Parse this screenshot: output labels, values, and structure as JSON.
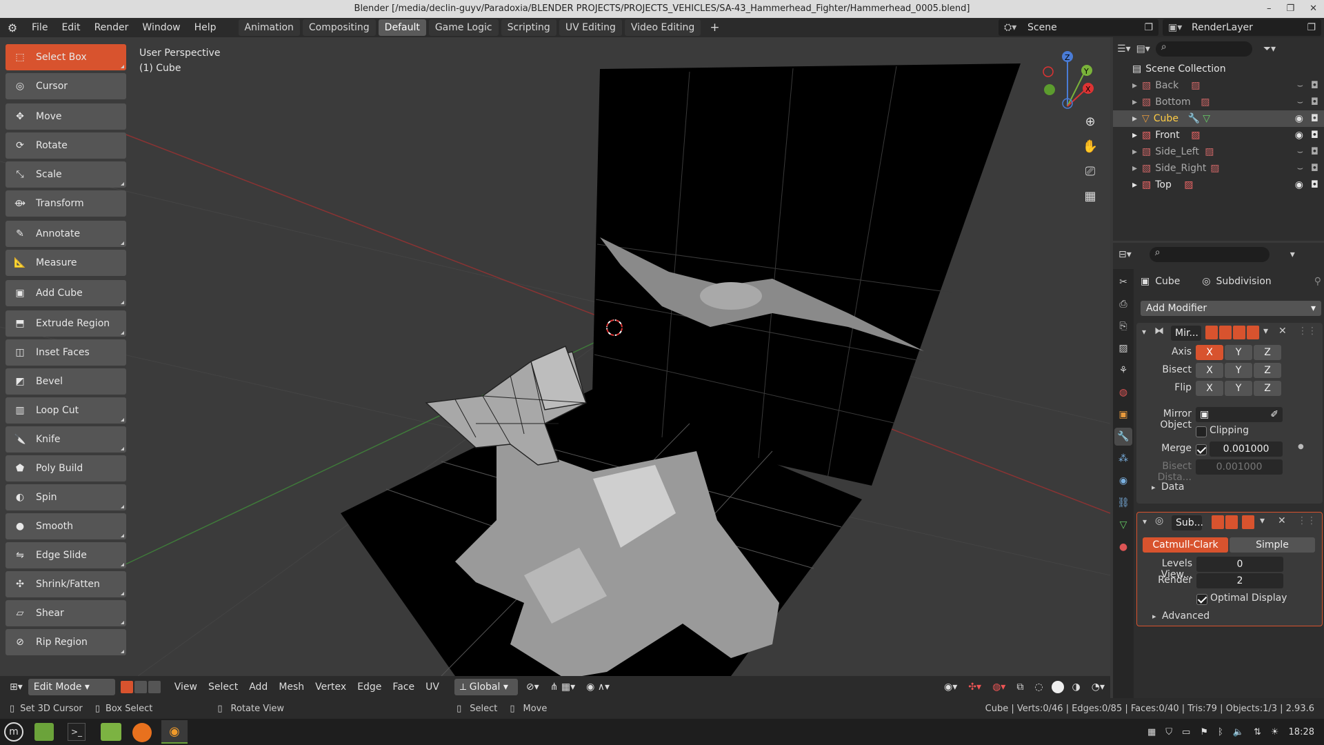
{
  "window": {
    "title": "Blender [/media/declin-guyv/Paradoxia/BLENDER PROJECTS/PROJECTS_VEHICLES/SA-43_Hammerhead_Fighter/Hammerhead_0005.blend]"
  },
  "menus": [
    "File",
    "Edit",
    "Render",
    "Window",
    "Help"
  ],
  "workspaces": [
    {
      "label": "Animation"
    },
    {
      "label": "Compositing"
    },
    {
      "label": "Default",
      "active": true
    },
    {
      "label": "Game Logic"
    },
    {
      "label": "Scripting"
    },
    {
      "label": "UV Editing"
    },
    {
      "label": "Video Editing"
    }
  ],
  "scene": {
    "label": "Scene",
    "render_layer": "RenderLayer"
  },
  "viewport": {
    "perspective": "User Perspective",
    "object": "(1) Cube"
  },
  "tools": [
    {
      "label": "Select Box",
      "icon": "select-box-icon",
      "active": true
    },
    {
      "label": "Cursor",
      "icon": "cursor-icon"
    },
    {
      "label": "Move",
      "icon": "move-icon"
    },
    {
      "label": "Rotate",
      "icon": "rotate-icon"
    },
    {
      "label": "Scale",
      "icon": "scale-icon"
    },
    {
      "label": "Transform",
      "icon": "transform-icon"
    },
    {
      "label": "Annotate",
      "icon": "annotate-icon"
    },
    {
      "label": "Measure",
      "icon": "measure-icon"
    },
    {
      "label": "Add Cube",
      "icon": "add-cube-icon"
    },
    {
      "label": "Extrude Region",
      "icon": "extrude-region-icon"
    },
    {
      "label": "Inset Faces",
      "icon": "inset-faces-icon"
    },
    {
      "label": "Bevel",
      "icon": "bevel-icon"
    },
    {
      "label": "Loop Cut",
      "icon": "loop-cut-icon"
    },
    {
      "label": "Knife",
      "icon": "knife-icon"
    },
    {
      "label": "Poly Build",
      "icon": "poly-build-icon"
    },
    {
      "label": "Spin",
      "icon": "spin-icon"
    },
    {
      "label": "Smooth",
      "icon": "smooth-icon"
    },
    {
      "label": "Edge Slide",
      "icon": "edge-slide-icon"
    },
    {
      "label": "Shrink/Fatten",
      "icon": "shrink-fatten-icon"
    },
    {
      "label": "Shear",
      "icon": "shear-icon"
    },
    {
      "label": "Rip Region",
      "icon": "rip-region-icon"
    }
  ],
  "vp_header": {
    "mode": "Edit Mode",
    "menus": [
      "View",
      "Select",
      "Add",
      "Mesh",
      "Vertex",
      "Edge",
      "Face",
      "UV"
    ],
    "orientation": "Global"
  },
  "statusbar": {
    "left": [
      "Set 3D Cursor",
      "Box Select",
      "Rotate View",
      "Select",
      "Move"
    ],
    "stats": "Cube | Verts:0/46 | Edges:0/85 | Faces:0/40 | Tris:79 | Objects:1/3 | 2.93.6"
  },
  "taskbar": {
    "time": "18:28"
  },
  "outliner": {
    "root": "Scene Collection",
    "items": [
      {
        "label": "Back",
        "state": "hidden"
      },
      {
        "label": "Bottom",
        "state": "hidden"
      },
      {
        "label": "Cube",
        "state": "active"
      },
      {
        "label": "Front",
        "state": "visible"
      },
      {
        "label": "Side_Left",
        "state": "hidden"
      },
      {
        "label": "Side_Right",
        "state": "hidden"
      },
      {
        "label": "Top",
        "state": "visible"
      }
    ]
  },
  "properties": {
    "object": "Cube",
    "modifier_context": "Subdivision",
    "add_modifier": "Add Modifier",
    "mirror": {
      "name": "Mir...",
      "axis_label": "Axis",
      "bisect_label": "Bisect",
      "flip_label": "Flip",
      "xyz": [
        "X",
        "Y",
        "Z"
      ],
      "mirror_object_label": "Mirror Object",
      "clipping_label": "Clipping",
      "merge_label": "Merge",
      "merge_value": "0.001000",
      "bisect_distance_label": "Bisect Dista...",
      "bisect_distance_value": "0.001000",
      "data_label": "Data"
    },
    "subsurf": {
      "name": "Sub...",
      "catmull": "Catmull-Clark",
      "simple": "Simple",
      "levels_label": "Levels View...",
      "levels_value": "0",
      "render_label": "Render",
      "render_value": "2",
      "optimal_label": "Optimal Display",
      "advanced_label": "Advanced"
    }
  },
  "colors": {
    "accent": "#d8532e",
    "active_text": "#ffcc44"
  }
}
